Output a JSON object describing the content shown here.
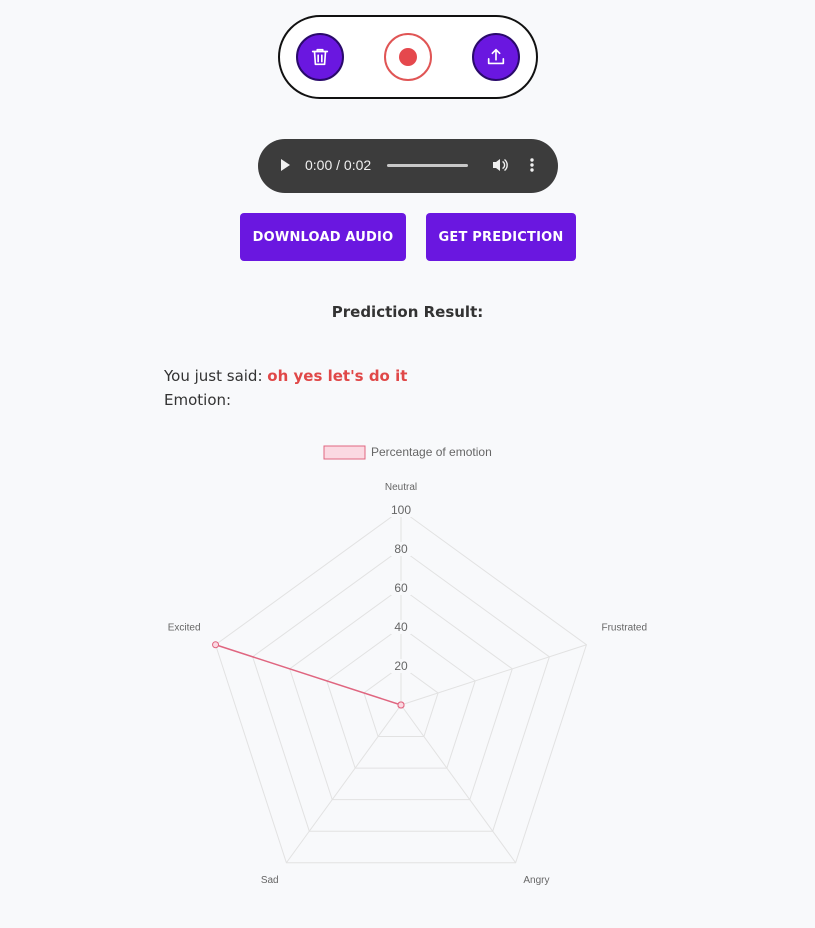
{
  "controls": {
    "delete_icon": "trash-icon",
    "record_icon": "record-icon",
    "upload_icon": "upload-icon"
  },
  "player": {
    "time": "0:00 / 0:02",
    "play_icon": "play-icon",
    "volume_icon": "volume-icon",
    "more_icon": "more-vertical-icon"
  },
  "buttons": {
    "download": "DOWNLOAD AUDIO",
    "predict": "GET PREDICTION"
  },
  "result": {
    "title": "Prediction Result:",
    "said_label": "You just said: ",
    "said_text": "oh yes let's do it",
    "emotion_label": "Emotion:"
  },
  "colors": {
    "accent": "#6a17e0",
    "record": "#e5484d",
    "series_line": "#e06680",
    "series_fill": "#fbd9e2"
  },
  "chart_data": {
    "type": "radar",
    "categories": [
      "Neutral",
      "Frustrated",
      "Angry",
      "Sad",
      "Excited"
    ],
    "series": [
      {
        "name": "Percentage of emotion",
        "values": [
          0,
          0,
          0,
          0,
          100
        ]
      }
    ],
    "ticks": [
      "20",
      "40",
      "60",
      "80",
      "100"
    ],
    "rmin": 0,
    "rmax": 100,
    "legend": "top"
  }
}
